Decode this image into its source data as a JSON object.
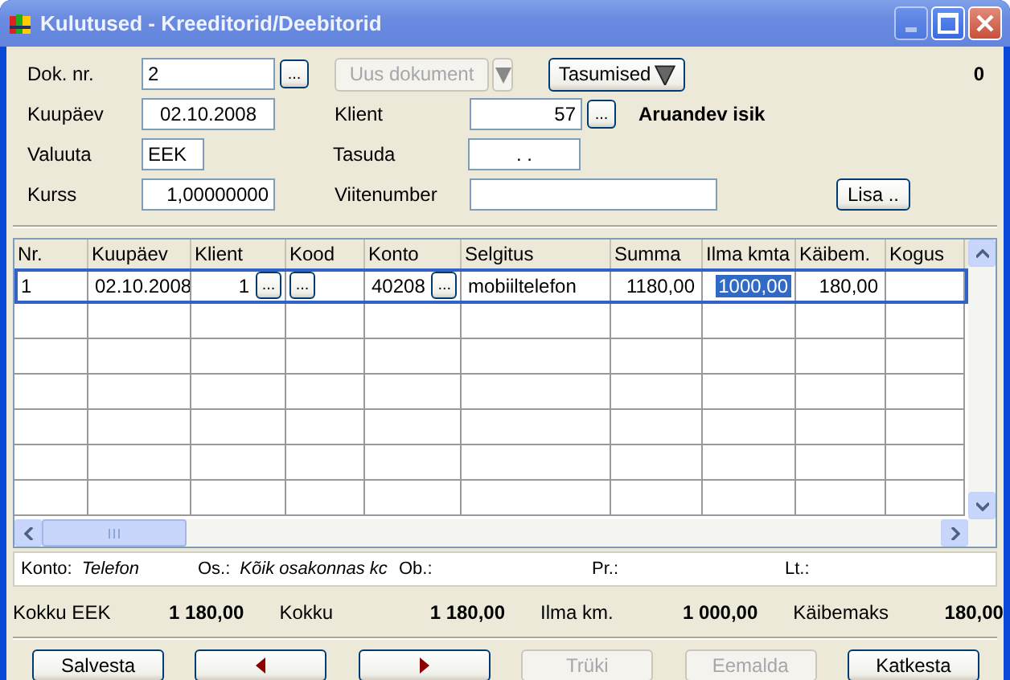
{
  "window": {
    "title": "Kulutused - Kreeditorid/Deebitorid",
    "minimize_disabled": true
  },
  "header": {
    "doc_nr": {
      "label": "Dok. nr.",
      "value": "2",
      "browse": "..."
    },
    "new_document_button": {
      "label": "Uus dokument",
      "disabled": true
    },
    "payments_button": {
      "label": "Tasumised"
    },
    "counter": "0",
    "date": {
      "label": "Kuupäev",
      "value": "02.10.2008"
    },
    "client": {
      "label": "Klient",
      "value": "57",
      "browse": "...",
      "name": "Aruandev isik"
    },
    "currency": {
      "label": "Valuuta",
      "value": "EEK"
    },
    "pay": {
      "label": "Tasuda",
      "value": ". ."
    },
    "rate": {
      "label": "Kurss",
      "value": "1,00000000"
    },
    "reference": {
      "label": "Viitenumber"
    },
    "add_button": {
      "label": "Lisa .."
    }
  },
  "table": {
    "columns": [
      "Nr.",
      "Kuupäev",
      "Klient",
      "Kood",
      "Konto",
      "Selgitus",
      "Summa",
      "Ilma kmta",
      "Käibem.",
      "Kogus"
    ],
    "rows": [
      {
        "selected": true,
        "cells": [
          {
            "text": "1"
          },
          {
            "text": "02.10.2008"
          },
          {
            "text": "1",
            "button": "..."
          },
          {
            "button": "..."
          },
          {
            "text": "40208",
            "button": "..."
          },
          {
            "text": "mobiiltelefon"
          },
          {
            "text": "1180,00"
          },
          {
            "text": "1000,00",
            "selected": true
          },
          {
            "text": "180,00"
          },
          {}
        ]
      }
    ]
  },
  "info_bar": [
    {
      "label": "Konto:",
      "value": "Telefon"
    },
    {
      "label": "Os.:",
      "value": "Kõik osakonnas kc"
    },
    {
      "label": "Ob.:"
    },
    {
      "label": "Pr.:"
    },
    {
      "label": "Lt.:"
    }
  ],
  "totals": [
    {
      "label": "Kokku EEK",
      "value": "1 180,00"
    },
    {
      "label": "Kokku",
      "value": "1 180,00"
    },
    {
      "label": "Ilma km.",
      "value": "1 000,00"
    },
    {
      "label": "Käibemaks",
      "value": "180,00"
    }
  ],
  "buttons": [
    {
      "kind": "text",
      "label": "Salvesta",
      "disabled": false
    },
    {
      "kind": "prev",
      "disabled": false
    },
    {
      "kind": "next",
      "disabled": false
    },
    {
      "kind": "text",
      "label": "Trüki",
      "disabled": true
    },
    {
      "kind": "text",
      "label": "Eemalda",
      "disabled": true
    },
    {
      "kind": "text",
      "label": "Katkesta",
      "disabled": false
    }
  ]
}
